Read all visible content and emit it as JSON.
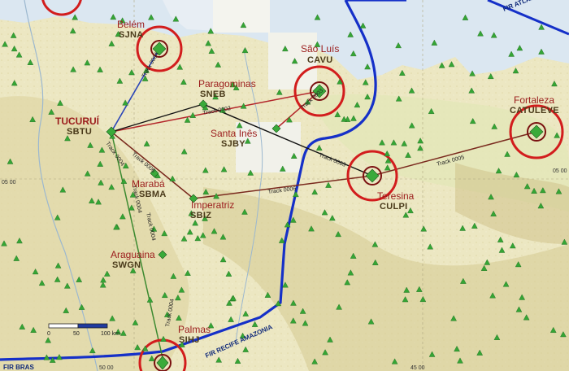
{
  "map": {
    "colors": {
      "land": "#ece7c2",
      "relief": "#d8cf9e",
      "forest": "#dce4b0",
      "sea": "#dbe7f1",
      "fir_boundary": "#1530c8",
      "route_red": "#b3262a",
      "route_dark": "#7a2a1e",
      "route_black": "#111111",
      "route_blue": "#2a45b8",
      "route_green": "#3c8a30",
      "ring_red": "#d21d1d",
      "navaid_green": "#35a535"
    },
    "airports": [
      {
        "city": "Belém",
        "code": "SJNA"
      },
      {
        "city": "São Luís",
        "code": "CAVU"
      },
      {
        "city": "Paragominas",
        "code": "SNEB"
      },
      {
        "city": "TUCURUÍ",
        "code": "SBTU"
      },
      {
        "city": "Santa Inês",
        "code": "SJBY"
      },
      {
        "city": "Fortaleza",
        "code": "CATULEVE"
      },
      {
        "city": "Marabá",
        "code": "SBMA"
      },
      {
        "city": "Imperatriz",
        "code": "SBIZ"
      },
      {
        "city": "Teresina",
        "code": "CULPI"
      },
      {
        "city": "Araguaina",
        "code": "SWGN"
      },
      {
        "city": "Palmas",
        "code": "SIHJ"
      }
    ],
    "tracks": [
      "Track 0002",
      "Track 0003",
      "Track 0004",
      "Track 0005",
      "Track 0006"
    ],
    "fir_labels": {
      "atlantico": "FIR ATLANTICO",
      "recife_amazonia": "FIR RECIFE AMAZONIA",
      "bottom_left": "FIR BRAS"
    },
    "coords": {
      "left_lat": "05 00",
      "right_lat": "05 00",
      "bottom_lon_1": "50 00",
      "bottom_lon_2": "45 00"
    },
    "scale": {
      "zero": "0",
      "mid": "50",
      "end": "100 km"
    }
  }
}
